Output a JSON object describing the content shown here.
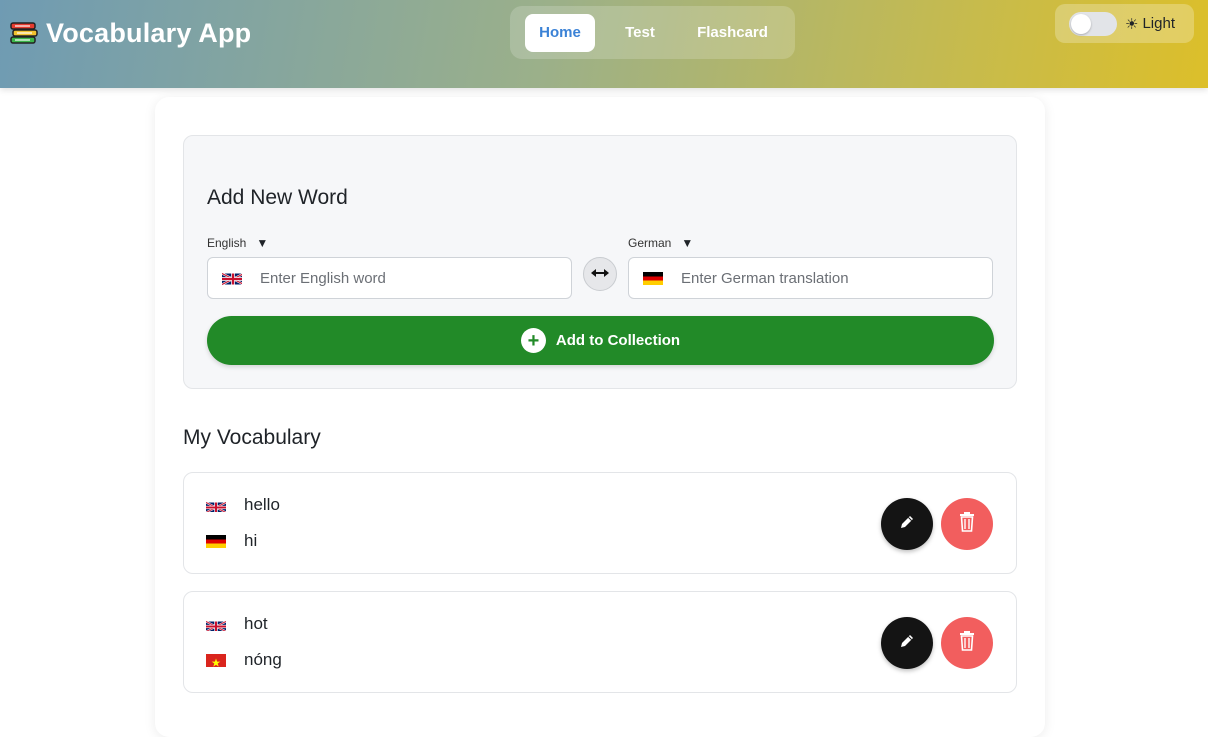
{
  "app": {
    "title": "Vocabulary App",
    "brand_icon": "books-icon"
  },
  "nav": {
    "tabs": [
      {
        "label": "Home",
        "active": true
      },
      {
        "label": "Test",
        "active": false
      },
      {
        "label": "Flashcard",
        "active": false
      }
    ]
  },
  "theme": {
    "label": "Light",
    "icon": "sun-icon",
    "dark_mode": false
  },
  "add_word": {
    "title": "Add New Word",
    "source_lang": {
      "label": "English",
      "flag": "uk-flag",
      "placeholder": "Enter English word",
      "value": ""
    },
    "target_lang": {
      "label": "German",
      "flag": "germany-flag",
      "placeholder": "Enter German translation",
      "value": ""
    },
    "swap_icon": "swap-arrows-icon",
    "button_label": "Add to Collection",
    "button_icon": "plus-circle-icon"
  },
  "vocabulary": {
    "title": "My Vocabulary",
    "items": [
      {
        "word": "hello",
        "word_flag": "uk-flag",
        "translation": "hi",
        "translation_flag": "germany-flag"
      },
      {
        "word": "hot",
        "word_flag": "uk-flag",
        "translation": "nóng",
        "translation_flag": "vietnam-flag"
      }
    ],
    "edit_icon": "pencil-icon",
    "delete_icon": "trash-icon"
  },
  "colors": {
    "accent_blue": "#3b82d6",
    "add_button_green": "#228a28",
    "edit_button": "#141414",
    "delete_button": "#f25e5e"
  }
}
